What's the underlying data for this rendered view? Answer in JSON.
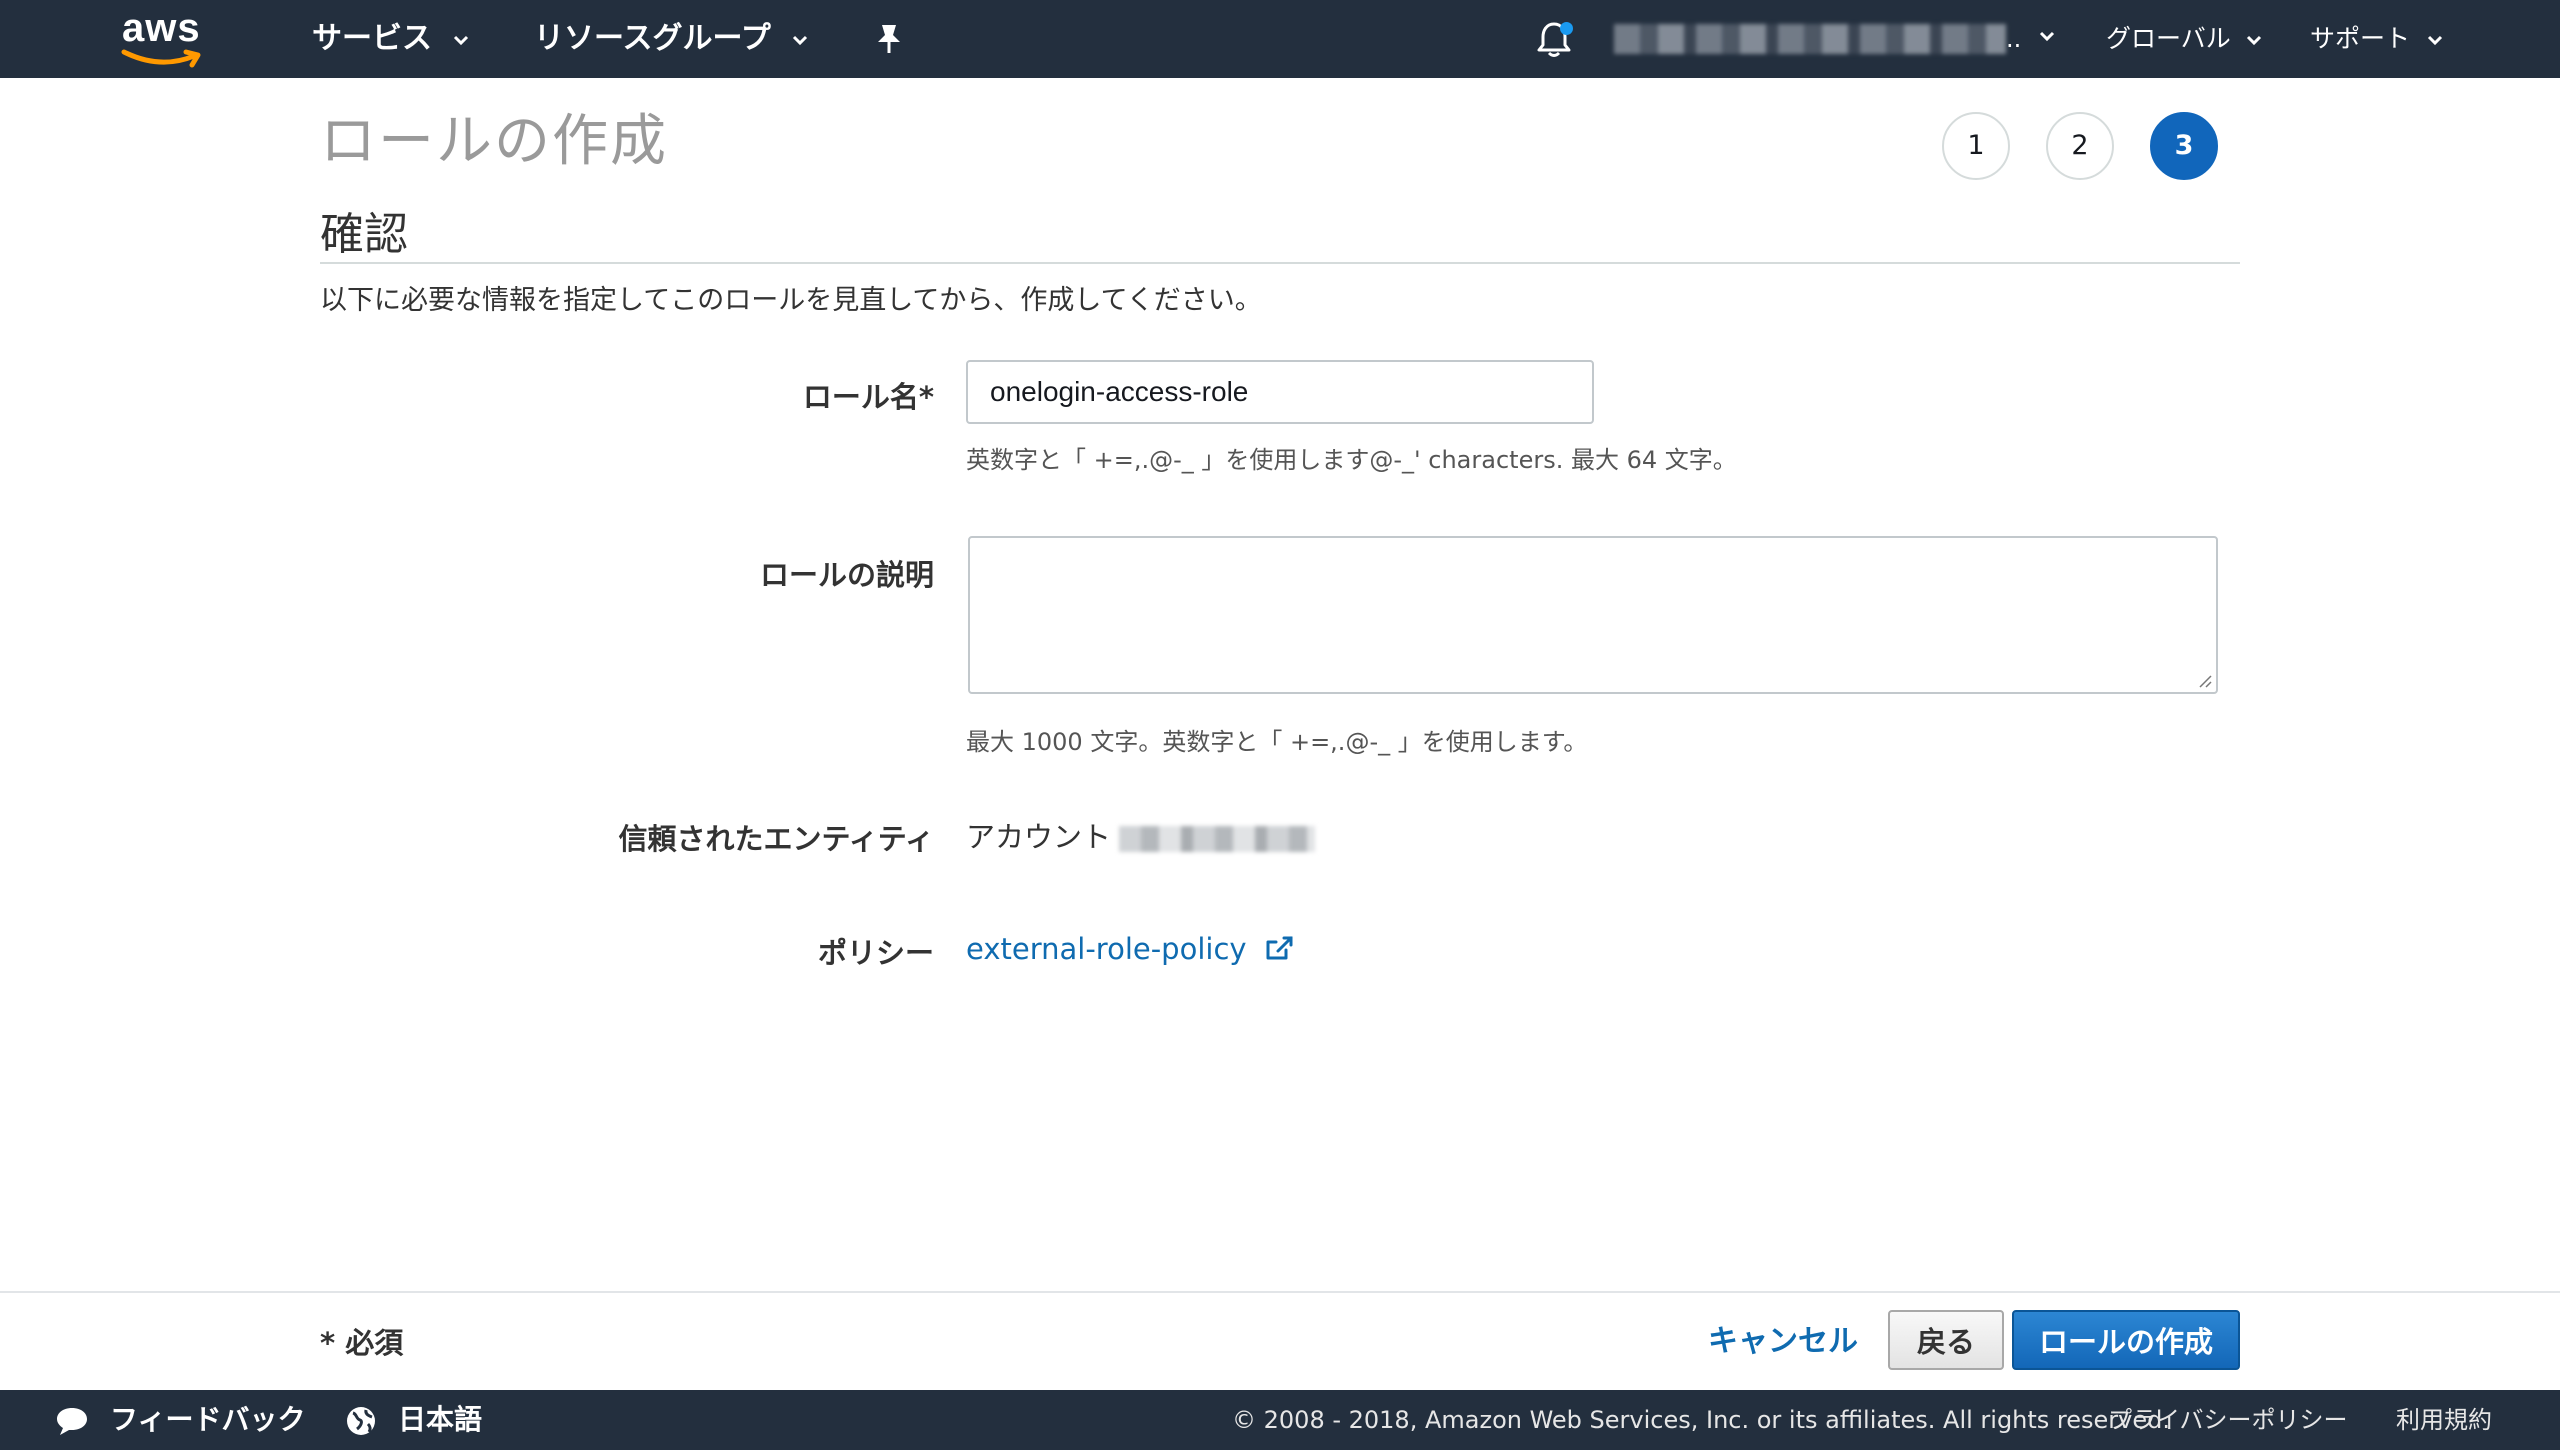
{
  "colors": {
    "nav_bg": "#232f3e",
    "accent": "#1166bb",
    "link": "#0f6bb0",
    "aws_smile": "#ff9900"
  },
  "nav": {
    "logo_text": "aws",
    "services": "サービス",
    "resource_groups": "リソースグループ",
    "account_suffix": "..",
    "region": "グローバル",
    "support": "サポート"
  },
  "page": {
    "title": "ロールの作成",
    "steps": [
      "1",
      "2",
      "3"
    ],
    "current_step": 3,
    "section_title": "確認",
    "lead": "以下に必要な情報を指定してこのロールを見直してから、作成してください。"
  },
  "form": {
    "role_name": {
      "label": "ロール名*",
      "value": "onelogin-access-role",
      "hint": "英数字と「 +=,.@-_ 」を使用します@-_' characters. 最大 64 文字。"
    },
    "role_description": {
      "label": "ロールの説明",
      "value": "",
      "hint": "最大 1000 文字。英数字と「 +=,.@-_ 」を使用します。"
    },
    "trusted_entity": {
      "label": "信頼されたエンティティ",
      "value": "アカウント"
    },
    "policy": {
      "label": "ポリシー",
      "value": "external-role-policy"
    }
  },
  "actions": {
    "required_note": "* 必須",
    "cancel": "キャンセル",
    "back": "戻る",
    "create": "ロールの作成"
  },
  "footer": {
    "feedback": "フィードバック",
    "language": "日本語",
    "copyright": "© 2008 - 2018, Amazon Web Services, Inc. or its affiliates. All rights reserved.",
    "privacy": "プライバシーポリシー",
    "terms": "利用規約"
  }
}
